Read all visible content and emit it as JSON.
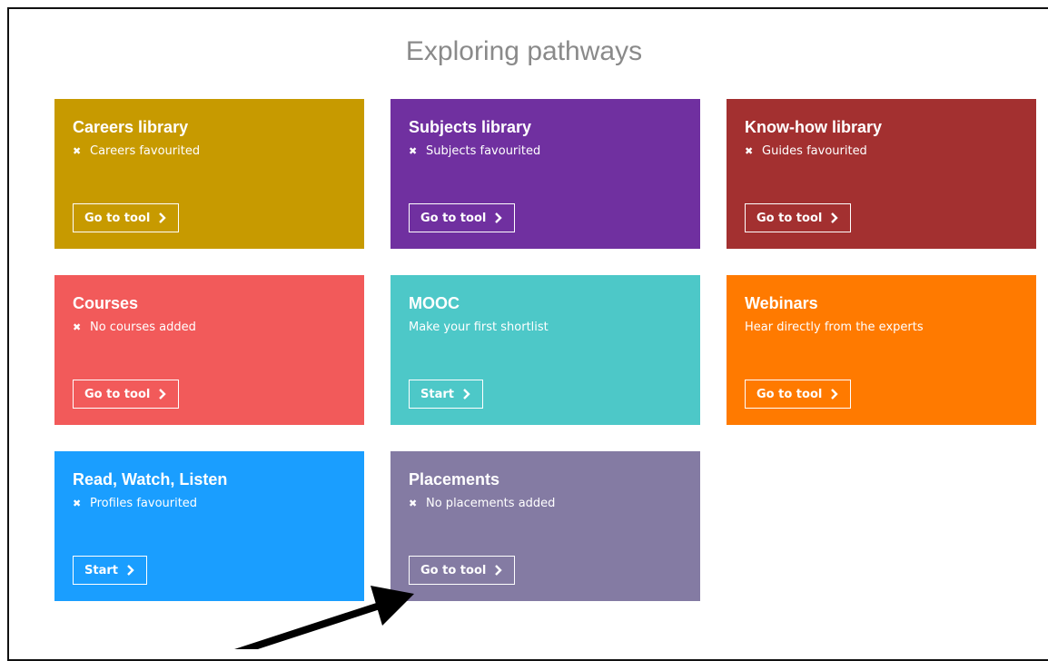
{
  "page": {
    "title": "Exploring pathways"
  },
  "tiles": [
    {
      "title": "Careers library",
      "status": "Careers favourited",
      "status_icon": "x-icon",
      "button": "Go to tool",
      "color": "#c79a00"
    },
    {
      "title": "Subjects library",
      "status": "Subjects favourited",
      "status_icon": "x-icon",
      "button": "Go to tool",
      "color": "#7030a0"
    },
    {
      "title": "Know-how library",
      "status": "Guides favourited",
      "status_icon": "x-icon",
      "button": "Go to tool",
      "color": "#a33030"
    },
    {
      "title": "Courses",
      "status": "No courses added",
      "status_icon": "x-icon",
      "button": "Go to tool",
      "color": "#f25a5a"
    },
    {
      "title": "MOOC",
      "status": "Make your first shortlist",
      "status_icon": "",
      "button": "Start",
      "color": "#4dc8c8"
    },
    {
      "title": "Webinars",
      "status": "Hear directly from the experts",
      "status_icon": "",
      "button": "Go to tool",
      "color": "#ff7a00"
    },
    {
      "title": "Read, Watch, Listen",
      "status": "Profiles favourited",
      "status_icon": "x-icon",
      "button": "Start",
      "color": "#1a9eff"
    },
    {
      "title": "Placements",
      "status": "No placements added",
      "status_icon": "x-icon",
      "button": "Go to tool",
      "color": "#847ba3"
    }
  ],
  "icons": {
    "x_glyph": "✖",
    "chevron": "chevron-right-icon"
  },
  "colors": {
    "title_text": "#8a8a8a",
    "annotation_arrow": "#000000"
  }
}
